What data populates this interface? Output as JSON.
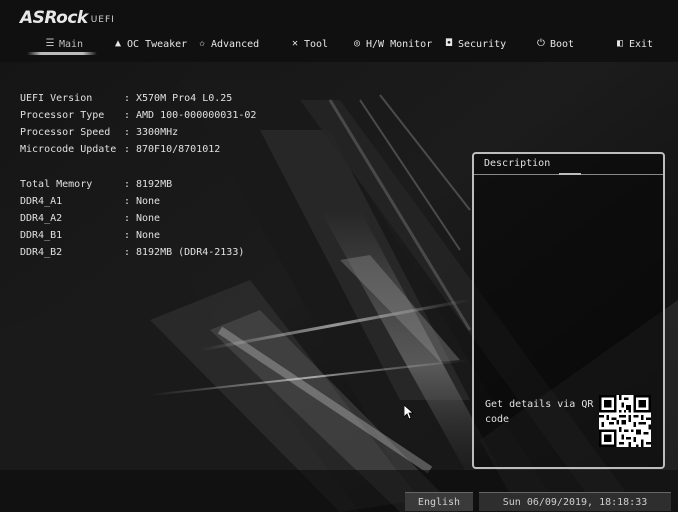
{
  "header": {
    "brand": "ASRock",
    "suffix": "UEFI"
  },
  "nav": {
    "items": [
      {
        "label": "Main",
        "icon": "list-icon",
        "glyph": "☰",
        "active": true
      },
      {
        "label": "OC Tweaker",
        "icon": "flame-icon",
        "glyph": "▲"
      },
      {
        "label": "Advanced",
        "icon": "star-icon",
        "glyph": "✩"
      },
      {
        "label": "Tool",
        "icon": "tools-icon",
        "glyph": "✕"
      },
      {
        "label": "H/W Monitor",
        "icon": "monitor-icon",
        "glyph": "◎"
      },
      {
        "label": "Security",
        "icon": "shield-icon",
        "glyph": "◘"
      },
      {
        "label": "Boot",
        "icon": "power-icon",
        "glyph": "⏻"
      },
      {
        "label": "Exit",
        "icon": "exit-icon",
        "glyph": "◧"
      }
    ]
  },
  "info": {
    "rows": [
      {
        "label": "UEFI Version",
        "sep": ":",
        "value": "X570M Pro4 L0.25"
      },
      {
        "label": "Processor Type",
        "sep": ":",
        "value": "AMD 100-000000031-02"
      },
      {
        "label": "Processor Speed",
        "sep": ":",
        "value": "3300MHz"
      },
      {
        "label": "Microcode Update",
        "sep": ":",
        "value": "870F10/8701012"
      }
    ],
    "memory_rows": [
      {
        "label": "Total Memory",
        "sep": ":",
        "value": "8192MB"
      },
      {
        "label": "DDR4_A1",
        "sep": ":",
        "value": "None"
      },
      {
        "label": "DDR4_A2",
        "sep": ":",
        "value": "None"
      },
      {
        "label": "DDR4_B1",
        "sep": ":",
        "value": "None"
      },
      {
        "label": "DDR4_B2",
        "sep": ":",
        "value": "8192MB (DDR4-2133)"
      }
    ]
  },
  "description": {
    "title": "Description",
    "qr_text": "Get details via QR code"
  },
  "status": {
    "language": "English",
    "datetime": "Sun 06/09/2019, 18:18:33"
  }
}
